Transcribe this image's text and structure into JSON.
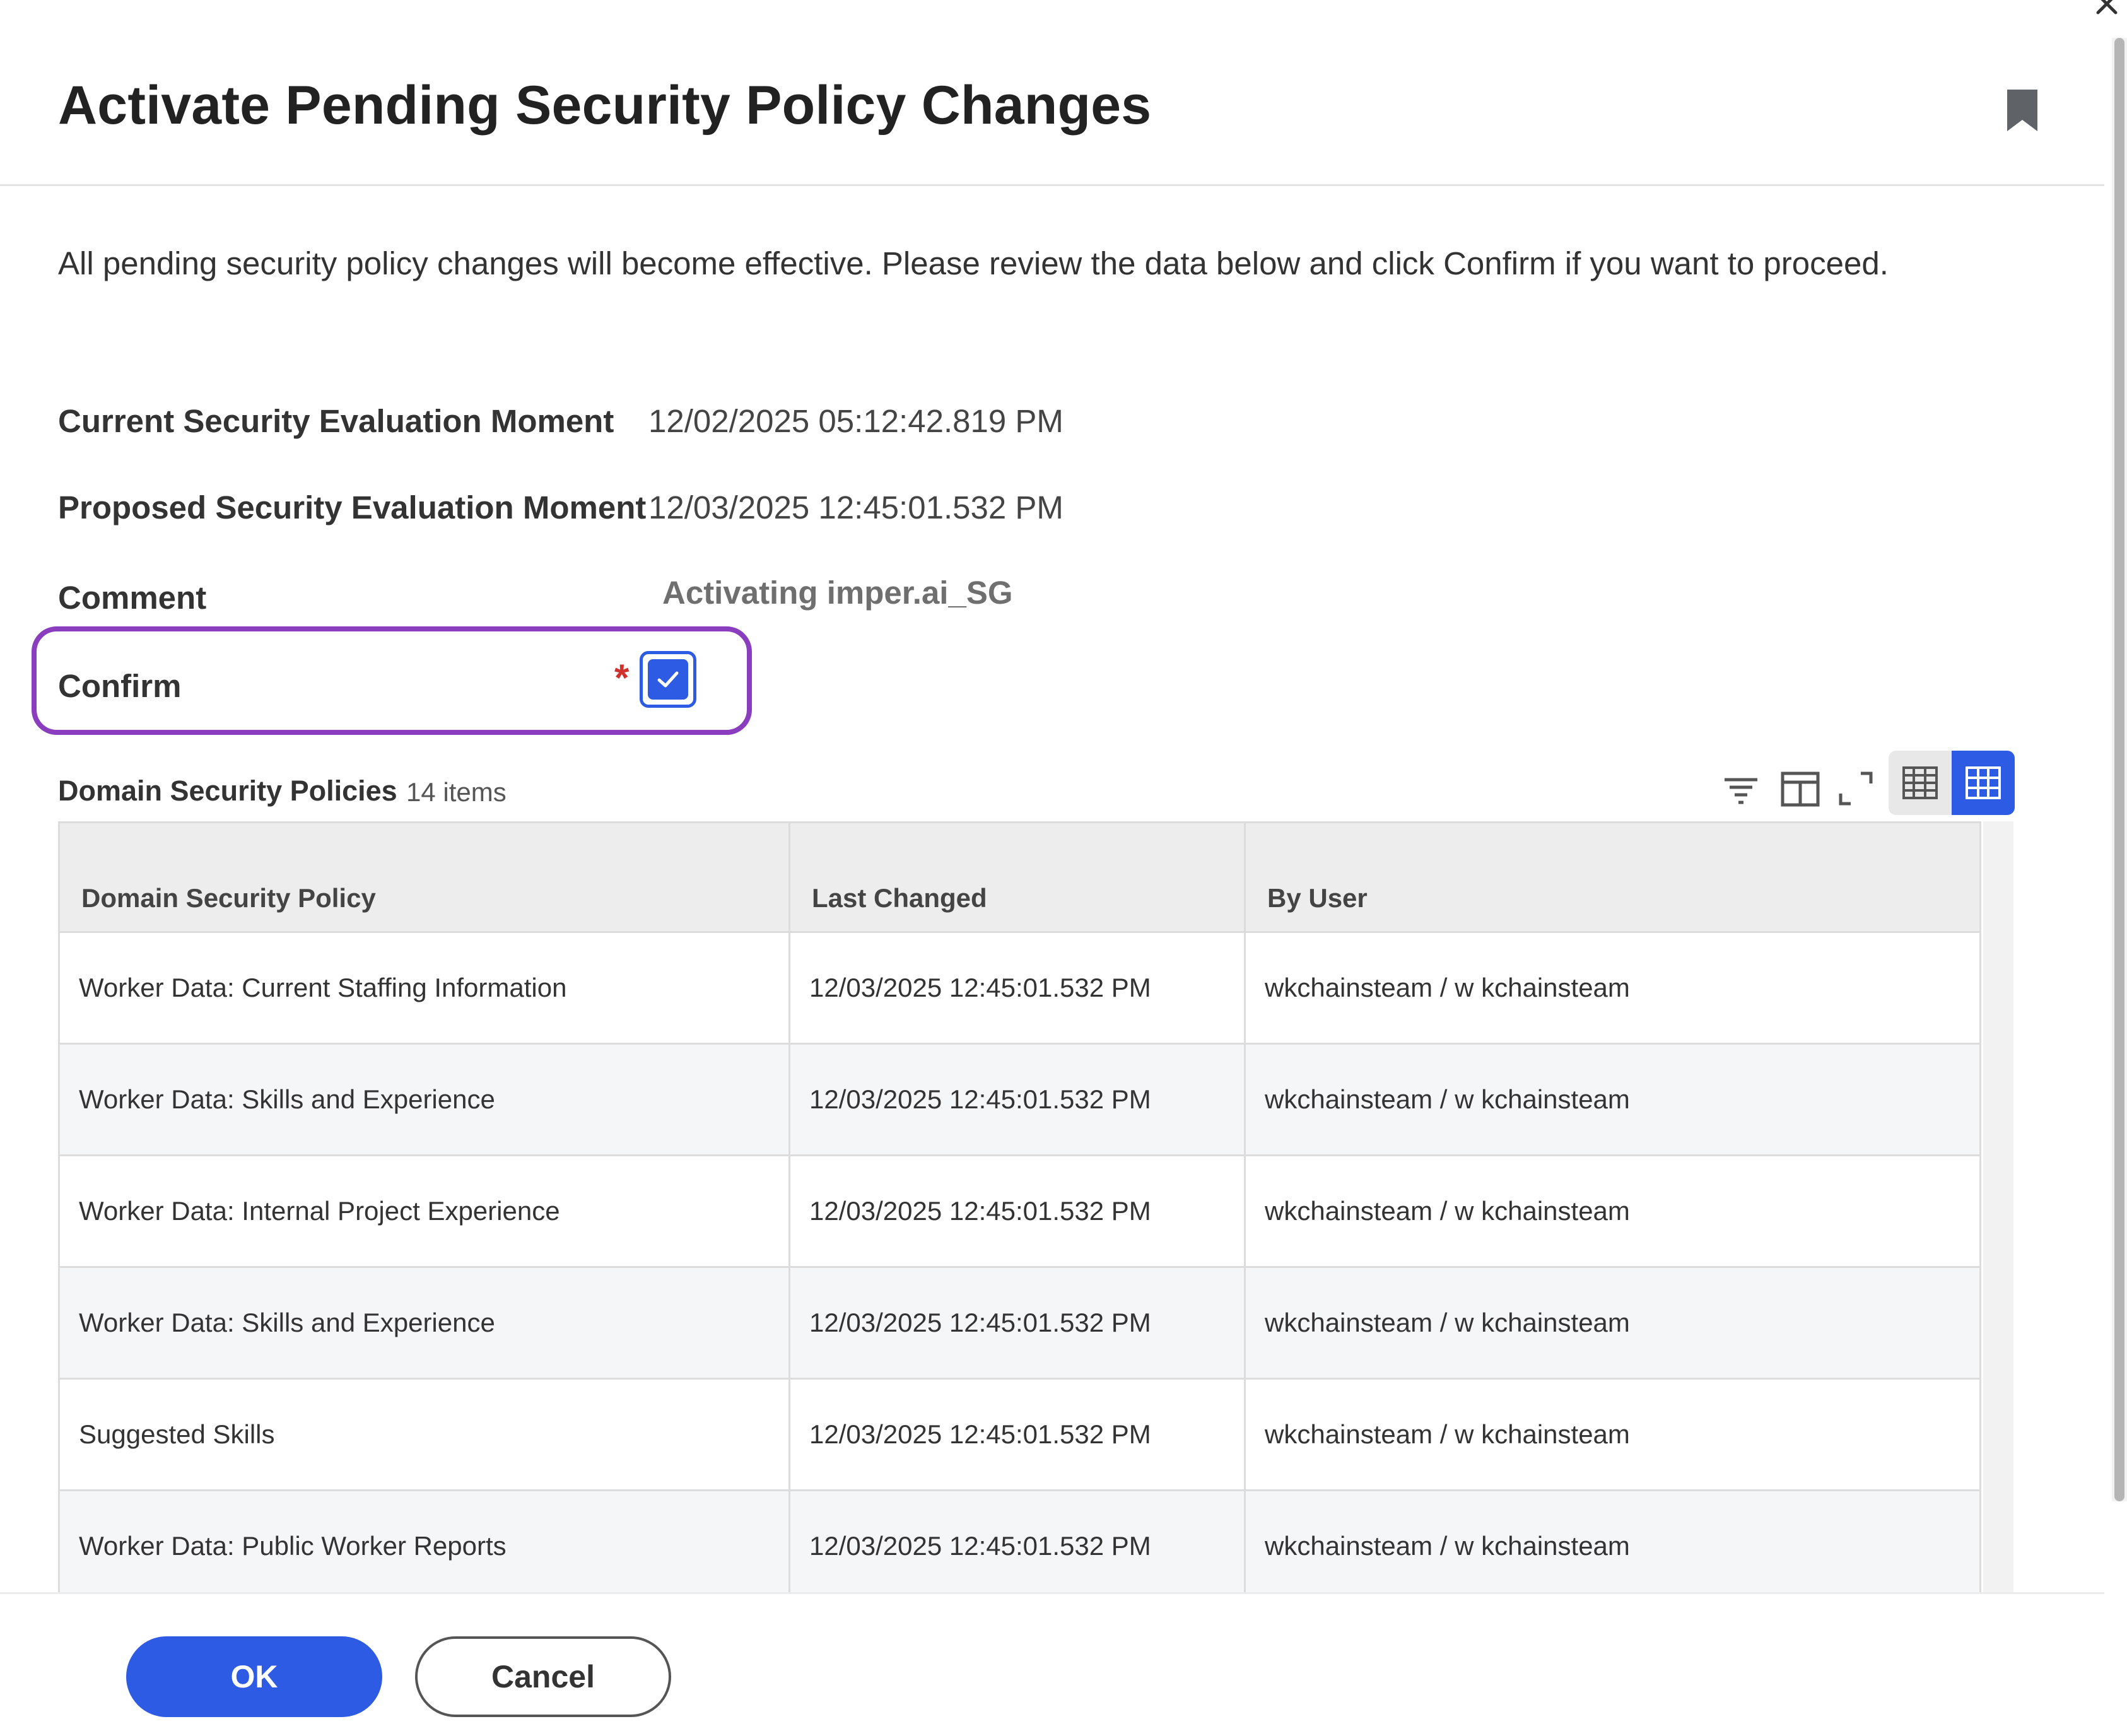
{
  "dialog": {
    "title": "Activate Pending Security Policy Changes",
    "description": "All pending security policy changes will become effective. Please review the data below and click Confirm if you want to proceed."
  },
  "fields": {
    "current_label": "Current Security Evaluation Moment",
    "current_value": "12/02/2025 05:12:42.819 PM",
    "proposed_label": "Proposed Security Evaluation Moment",
    "proposed_value": "12/03/2025 12:45:01.532 PM",
    "comment_label": "Comment",
    "comment_value": "Activating imper.ai_SG",
    "confirm_label": "Confirm",
    "confirm_required_mark": "*",
    "confirm_checked": true
  },
  "grid": {
    "title": "Domain Security Policies",
    "count": "14 items",
    "columns": [
      "Domain Security Policy",
      "Last Changed",
      "By User"
    ],
    "rows": [
      [
        "Worker Data: Current Staffing Information",
        "12/03/2025 12:45:01.532 PM",
        "wkchainsteam / w kchainsteam"
      ],
      [
        "Worker Data: Skills and Experience",
        "12/03/2025 12:45:01.532 PM",
        "wkchainsteam / w kchainsteam"
      ],
      [
        "Worker Data: Internal Project Experience",
        "12/03/2025 12:45:01.532 PM",
        "wkchainsteam / w kchainsteam"
      ],
      [
        "Worker Data: Skills and Experience",
        "12/03/2025 12:45:01.532 PM",
        "wkchainsteam / w kchainsteam"
      ],
      [
        "Suggested Skills",
        "12/03/2025 12:45:01.532 PM",
        "wkchainsteam / w kchainsteam"
      ],
      [
        "Worker Data: Public Worker Reports",
        "12/03/2025 12:45:01.532 PM",
        "wkchainsteam / w kchainsteam"
      ]
    ],
    "toolbar_icons": [
      "filter-icon",
      "column-layout-icon",
      "expand-icon",
      "table-view-icon",
      "grid-view-icon"
    ]
  },
  "footer": {
    "ok_label": "OK",
    "cancel_label": "Cancel"
  },
  "colors": {
    "accent": "#2d5be3",
    "highlight": "#8a3dbe",
    "required": "#d0312d"
  }
}
